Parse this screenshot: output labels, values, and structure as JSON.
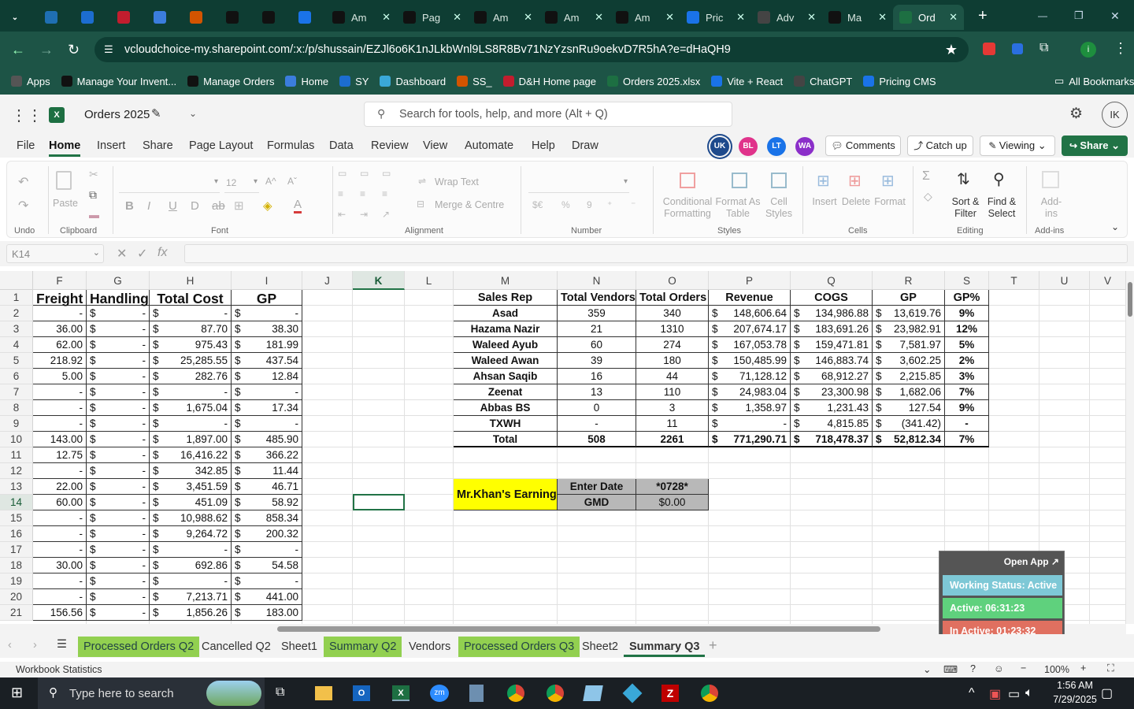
{
  "browser": {
    "tabs": [
      {
        "label": "",
        "icon": "chevron-down-icon",
        "color": "#0e3d33"
      },
      {
        "label": "",
        "icon": "app-icon",
        "color": "#1f6fb2"
      },
      {
        "label": "",
        "icon": "ec-icon",
        "color": "#1c6dd0"
      },
      {
        "label": "",
        "icon": "dh-icon",
        "color": "#c21d2e"
      },
      {
        "label": "",
        "icon": "google-icon",
        "color": "#3b7ddd"
      },
      {
        "label": "",
        "icon": "shop-icon",
        "color": "#d35400"
      },
      {
        "label": "",
        "icon": "amazon-icon",
        "color": "#111"
      },
      {
        "label": "",
        "icon": "amazon-icon",
        "color": "#111"
      },
      {
        "label": "",
        "icon": "dollar-icon",
        "color": "#1a73e8"
      },
      {
        "label": "Am",
        "icon": "amazon-icon",
        "color": "#111"
      },
      {
        "label": "Pag",
        "icon": "amazon-icon",
        "color": "#111"
      },
      {
        "label": "Am",
        "icon": "amazon-icon",
        "color": "#111"
      },
      {
        "label": "Am",
        "icon": "amazon-icon",
        "color": "#111"
      },
      {
        "label": "Am",
        "icon": "amazon-icon",
        "color": "#111"
      },
      {
        "label": "Pric",
        "icon": "dollar-icon",
        "color": "#1a73e8"
      },
      {
        "label": "Adv",
        "icon": "chatgpt-icon",
        "color": "#444"
      },
      {
        "label": "Ma",
        "icon": "amazon-icon",
        "color": "#111"
      },
      {
        "label": "Ord",
        "icon": "excel-icon",
        "color": "#1d6f42"
      }
    ],
    "url": "vcloudchoice-my.sharepoint.com/:x:/p/shussain/EZJl6o6K1nJLkbWnl9LS8R8Bv71NzYzsnRu9oekvD7R5hA?e=dHaQH9",
    "bookmarks": [
      "Apps",
      "Manage Your Invent...",
      "Manage Orders",
      "Home",
      "SY",
      "Dashboard",
      "SS_",
      "D&H Home page",
      "Orders 2025.xlsx",
      "Vite + React",
      "ChatGPT",
      "Pricing CMS"
    ],
    "all_bookmarks": "All Bookmarks"
  },
  "excel": {
    "file_name": "Orders 2025",
    "search_placeholder": "Search for tools, help, and more (Alt + Q)",
    "user_initials": "IK",
    "menu": [
      "File",
      "Home",
      "Insert",
      "Share",
      "Page Layout",
      "Formulas",
      "Data",
      "Review",
      "View",
      "Automate",
      "Help",
      "Draw"
    ],
    "active_menu": "Home",
    "collaborators": [
      "UK",
      "BL",
      "LT",
      "WA"
    ],
    "comments": "Comments",
    "catch_up": "Catch up",
    "viewing": "Viewing",
    "share": "Share",
    "name_box": "K14",
    "font_size": "12",
    "ribbon": {
      "undo_group": "Undo",
      "clipboard_group": "Clipboard",
      "paste": "Paste",
      "font_group": "Font",
      "alignment_group": "Alignment",
      "number_group": "Number",
      "styles_group": "Styles",
      "cells_group": "Cells",
      "editing_group": "Editing",
      "addins_group": "Add-ins",
      "wrap_text": "Wrap Text",
      "merge_centre": "Merge & Centre",
      "conditional_formatting": "Conditional Formatting",
      "format_as_table": "Format As Table",
      "cell_styles": "Cell Styles",
      "insert": "Insert",
      "delete": "Delete",
      "format": "Format",
      "sort_filter": "Sort & Filter",
      "find_select": "Find & Select",
      "addins": "Add-ins"
    }
  },
  "columns": [
    "F",
    "G",
    "H",
    "I",
    "J",
    "K",
    "L",
    "M",
    "N",
    "O",
    "P",
    "Q",
    "R",
    "S",
    "T",
    "U",
    "V"
  ],
  "rows": [
    "1",
    "2",
    "3",
    "4",
    "5",
    "6",
    "7",
    "8",
    "9",
    "10",
    "11",
    "12",
    "13",
    "14",
    "15",
    "16",
    "17",
    "18",
    "19",
    "20",
    "21"
  ],
  "left_table": {
    "headers": [
      "Freight",
      "Handling",
      "Total Cost",
      "GP"
    ],
    "rows": [
      [
        "-",
        "-",
        "-",
        "-"
      ],
      [
        "36.00",
        "-",
        "87.70",
        "38.30"
      ],
      [
        "62.00",
        "-",
        "975.43",
        "181.99"
      ],
      [
        "218.92",
        "-",
        "25,285.55",
        "437.54"
      ],
      [
        "5.00",
        "-",
        "282.76",
        "12.84"
      ],
      [
        "-",
        "-",
        "-",
        "-"
      ],
      [
        "-",
        "-",
        "1,675.04",
        "17.34"
      ],
      [
        "-",
        "-",
        "-",
        "-"
      ],
      [
        "143.00",
        "-",
        "1,897.00",
        "485.90"
      ],
      [
        "12.75",
        "-",
        "16,416.22",
        "366.22"
      ],
      [
        "-",
        "-",
        "342.85",
        "11.44"
      ],
      [
        "22.00",
        "-",
        "3,451.59",
        "46.71"
      ],
      [
        "60.00",
        "-",
        "451.09",
        "58.92"
      ],
      [
        "-",
        "-",
        "10,988.62",
        "858.34"
      ],
      [
        "-",
        "-",
        "9,264.72",
        "200.32"
      ],
      [
        "-",
        "-",
        "-",
        "-"
      ],
      [
        "30.00",
        "-",
        "692.86",
        "54.58"
      ],
      [
        "-",
        "-",
        "-",
        "-"
      ],
      [
        "-",
        "-",
        "7,213.71",
        "441.00"
      ],
      [
        "156.56",
        "-",
        "1,856.26",
        "183.00"
      ]
    ]
  },
  "summary_table": {
    "headers": [
      "Sales Rep",
      "Total Vendors",
      "Total Orders",
      "Revenue",
      "COGS",
      "GP",
      "GP%"
    ],
    "rows": [
      [
        "Asad",
        "359",
        "340",
        "148,606.64",
        "134,986.88",
        "13,619.76",
        "9%"
      ],
      [
        "Hazama Nazir",
        "21",
        "1310",
        "207,674.17",
        "183,691.26",
        "23,982.91",
        "12%"
      ],
      [
        "Waleed Ayub",
        "60",
        "274",
        "167,053.78",
        "159,471.81",
        "7,581.97",
        "5%"
      ],
      [
        "Waleed Awan",
        "39",
        "180",
        "150,485.99",
        "146,883.74",
        "3,602.25",
        "2%"
      ],
      [
        "Ahsan Saqib",
        "16",
        "44",
        "71,128.12",
        "68,912.27",
        "2,215.85",
        "3%"
      ],
      [
        "Zeenat",
        "13",
        "110",
        "24,983.04",
        "23,300.98",
        "1,682.06",
        "7%"
      ],
      [
        "Abbas BS",
        "0",
        "3",
        "1,358.97",
        "1,231.43",
        "127.54",
        "9%"
      ],
      [
        "TXWH",
        "-",
        "11",
        "-",
        "4,815.85",
        "(341.42)",
        "-"
      ]
    ],
    "total": [
      "Total",
      "508",
      "2261",
      "771,290.71",
      "718,478.37",
      "52,812.34",
      "7%"
    ]
  },
  "earning": {
    "label": "Mr.Khan's Earning",
    "enter_date": "Enter Date",
    "date_value": "*0728*",
    "gmd": "GMD",
    "gmd_value": "$0.00"
  },
  "widget": {
    "open_app": "Open App ↗",
    "working": "Working Status: Active",
    "active": "Active: 06:31:23",
    "inactive": "In Active: 01:23:32"
  },
  "sheets": [
    "Processed Orders Q2",
    "Cancelled Q2",
    "Sheet1",
    "Summary Q2",
    "Vendors",
    "Processed Orders Q3",
    "Sheet2",
    "Summary Q3"
  ],
  "status": {
    "left": "Workbook Statistics",
    "zoom": "100%"
  },
  "taskbar": {
    "search": "Type here to search",
    "time": "1:56 AM",
    "date": "7/29/2025"
  }
}
